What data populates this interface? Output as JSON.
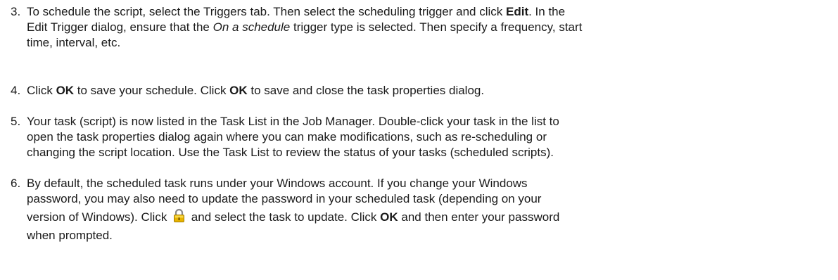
{
  "steps": [
    {
      "number": "3.",
      "lines": [
        [
          "To schedule the script, select the Triggers tab. Then select the scheduling trigger and click ",
          "Edit",
          ". In the"
        ],
        [
          "Edit Trigger dialog, ensure that the ",
          "On a schedule",
          " trigger type is selected. Then specify a frequency, start"
        ],
        [
          "time, interval, etc."
        ]
      ]
    },
    {
      "number": "4.",
      "lines": [
        [
          "Click ",
          "OK",
          " to save your schedule. Click ",
          "OK",
          " to save and close the task properties dialog."
        ]
      ]
    },
    {
      "number": "5.",
      "lines": [
        [
          "Your task (script) is now listed in the Task List in the Job Manager. Double-click your task in the list to"
        ],
        [
          "open the task properties dialog again where you can make modifications, such as re-scheduling or"
        ],
        [
          "changing the script location. Use the Task List to review the status of your tasks (scheduled scripts)."
        ]
      ]
    },
    {
      "number": "6.",
      "lines": [
        [
          "By default, the scheduled task runs under your Windows account. If you change your Windows"
        ],
        [
          "password, you may also need to update the password in your scheduled task (depending on your"
        ],
        [
          "version of Windows). Click ",
          " and select the task to update. Click ",
          "OK",
          " and then enter your password"
        ],
        [
          "when prompted."
        ]
      ]
    }
  ],
  "icons": {
    "lock": "lock-icon"
  },
  "colors": {
    "text": "#1a1a1a",
    "lock_body": "#e8b400",
    "lock_shackle": "#8a8a8a"
  }
}
